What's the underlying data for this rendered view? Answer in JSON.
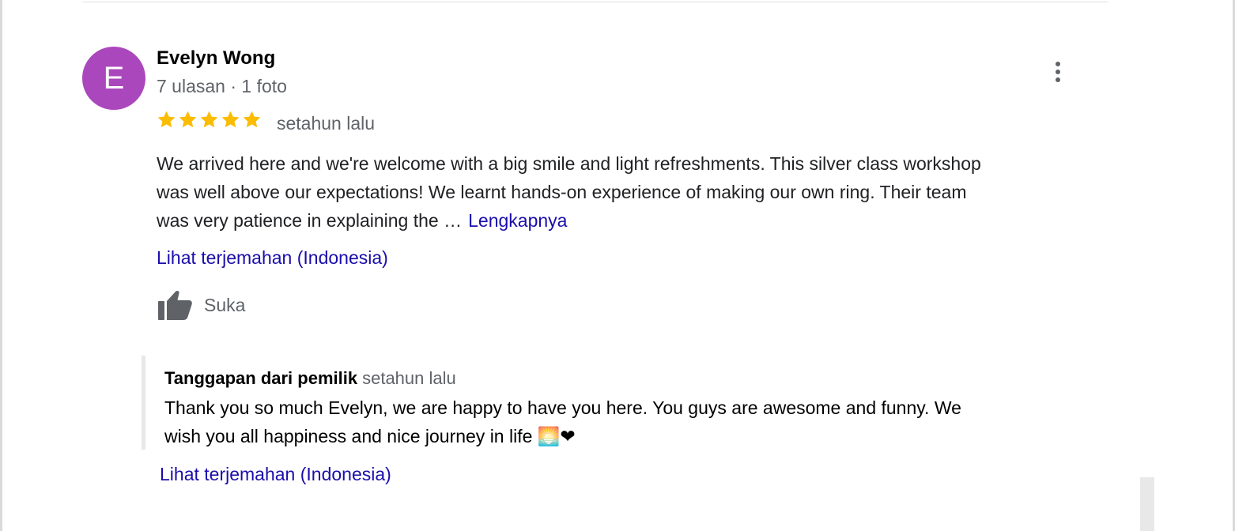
{
  "review": {
    "avatar_letter": "E",
    "avatar_color": "#ab47bc",
    "reviewer_name": "Evelyn Wong",
    "reviewer_meta": "7 ulasan · 1 foto",
    "rating": 5,
    "rating_max": 5,
    "star_color": "#fbbc04",
    "time": "setahun lalu",
    "text_lines": [
      "We arrived here and we're welcome with a big smile and light refreshments. This silver class workshop",
      "was well above our expectations! We learnt hands-on experience of making our own ring. Their team",
      "was very patience in explaining the …"
    ],
    "more_label": "Lengkapnya",
    "translate_label": "Lihat terjemahan (Indonesia)",
    "like_label": "Suka",
    "more_options_icon": "more-vert-icon",
    "like_icon": "thumb-up-icon"
  },
  "owner_response": {
    "title": "Tanggapan dari pemilik",
    "time": "setahun lalu",
    "text_lines": [
      "Thank you so much Evelyn, we are happy to have you here. You guys are awesome and funny. We",
      "wish you all happiness and nice journey in life 🌅❤"
    ],
    "translate_label": "Lihat terjemahan (Indonesia)"
  },
  "colors": {
    "link": "#1a0dab",
    "secondary_text": "#5f6368"
  }
}
